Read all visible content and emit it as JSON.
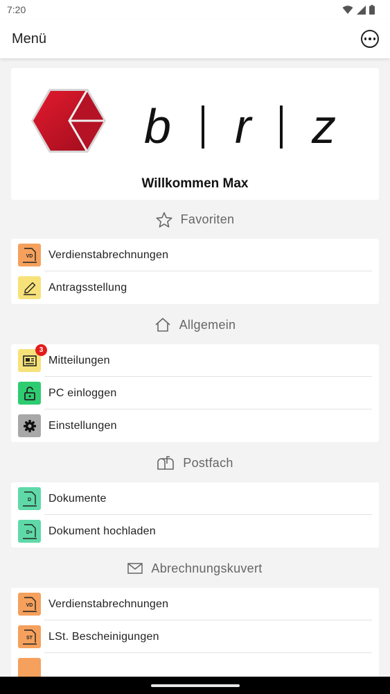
{
  "status_bar": {
    "time": "7:20"
  },
  "app_bar": {
    "title": "Menü"
  },
  "logo": {
    "letters": [
      "b",
      "r",
      "z"
    ]
  },
  "welcome": "Willkommen Max",
  "sections": {
    "favoriten": {
      "title": "Favoriten",
      "items": [
        {
          "label": "Verdienstabrechnungen",
          "icon_text": "VD"
        },
        {
          "label": "Antragsstellung"
        }
      ]
    },
    "allgemein": {
      "title": "Allgemein",
      "items": [
        {
          "label": "Mitteilungen",
          "badge": "3"
        },
        {
          "label": "PC einloggen"
        },
        {
          "label": "Einstellungen"
        }
      ]
    },
    "postfach": {
      "title": "Postfach",
      "items": [
        {
          "label": "Dokumente",
          "icon_text": "D"
        },
        {
          "label": "Dokument hochladen",
          "icon_text": "D+"
        }
      ]
    },
    "abrechnungskuvert": {
      "title": "Abrechnungskuvert",
      "items": [
        {
          "label": "Verdienstabrechnungen",
          "icon_text": "VD"
        },
        {
          "label": "LSt. Bescheinigungen",
          "icon_text": "ST"
        }
      ]
    }
  },
  "colors": {
    "orange_icon": "#f5a05c",
    "yellow_icon": "#f7e27a",
    "green_icon": "#2ecc71",
    "gray_icon": "#a8a8a8",
    "teal_icon": "#5fd9a8",
    "logo_red": "#c8102e",
    "badge_red": "#e21c1c"
  }
}
